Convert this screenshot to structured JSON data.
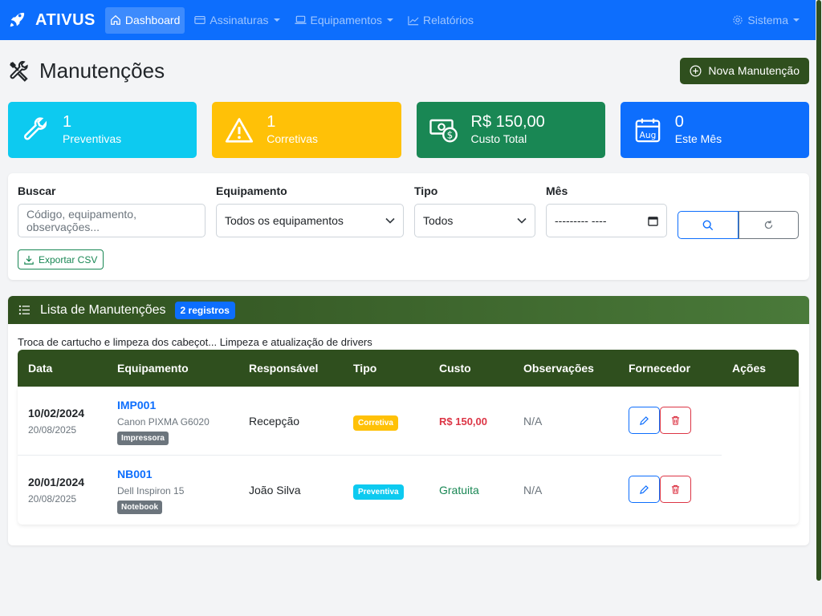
{
  "navbar": {
    "brand": "ATIVUS",
    "items": [
      {
        "label": "Dashboard",
        "icon": "home-icon",
        "active": true
      },
      {
        "label": "Assinaturas",
        "icon": "card-icon",
        "dropdown": true
      },
      {
        "label": "Equipamentos",
        "icon": "laptop-icon",
        "dropdown": true
      },
      {
        "label": "Relatórios",
        "icon": "chart-line-icon"
      }
    ],
    "right": {
      "label": "Sistema",
      "icon": "gear-icon",
      "dropdown": true
    }
  },
  "header": {
    "title": "Manutenções",
    "new_button": "Nova Manutenção"
  },
  "stats": [
    {
      "value": "1",
      "label": "Preventivas",
      "color": "#0dcaf0",
      "icon": "wrench-icon"
    },
    {
      "value": "1",
      "label": "Corretivas",
      "color": "#ffc107",
      "icon": "warning-icon"
    },
    {
      "value": "R$ 150,00",
      "label": "Custo Total",
      "color": "#198754",
      "icon": "cash-icon"
    },
    {
      "value": "0",
      "label": "Este Mês",
      "color": "#0d6efd",
      "icon": "calendar-icon"
    }
  ],
  "filters": {
    "search": {
      "label": "Buscar",
      "placeholder": "Código, equipamento, observações..."
    },
    "equipment": {
      "label": "Equipamento",
      "value": "Todos os equipamentos"
    },
    "type": {
      "label": "Tipo",
      "value": "Todos"
    },
    "month": {
      "label": "Mês",
      "value": "--------- ----"
    },
    "export_button": "Exportar CSV"
  },
  "list": {
    "title": "Lista de Manutenções",
    "count_badge": "2 registros",
    "description_line": "Troca de cartucho e limpeza dos cabeçot... Limpeza e atualização de drivers",
    "columns": [
      "Data",
      "Equipamento",
      "Responsável",
      "Tipo",
      "Custo",
      "Observações",
      "Fornecedor",
      "Ações"
    ],
    "rows": [
      {
        "date": "10/02/2024",
        "created": "20/08/2025",
        "code": "IMP001",
        "equipment": "Canon PIXMA G6020",
        "category": "Impressora",
        "responsible": "Recepção",
        "type": "Corretiva",
        "cost": "R$ 150,00",
        "notes": "N/A"
      },
      {
        "date": "20/01/2024",
        "created": "20/08/2025",
        "code": "NB001",
        "equipment": "Dell Inspiron 15",
        "category": "Notebook",
        "responsible": "João Silva",
        "type": "Preventiva",
        "cost": "Gratuita",
        "notes": "N/A"
      }
    ]
  }
}
